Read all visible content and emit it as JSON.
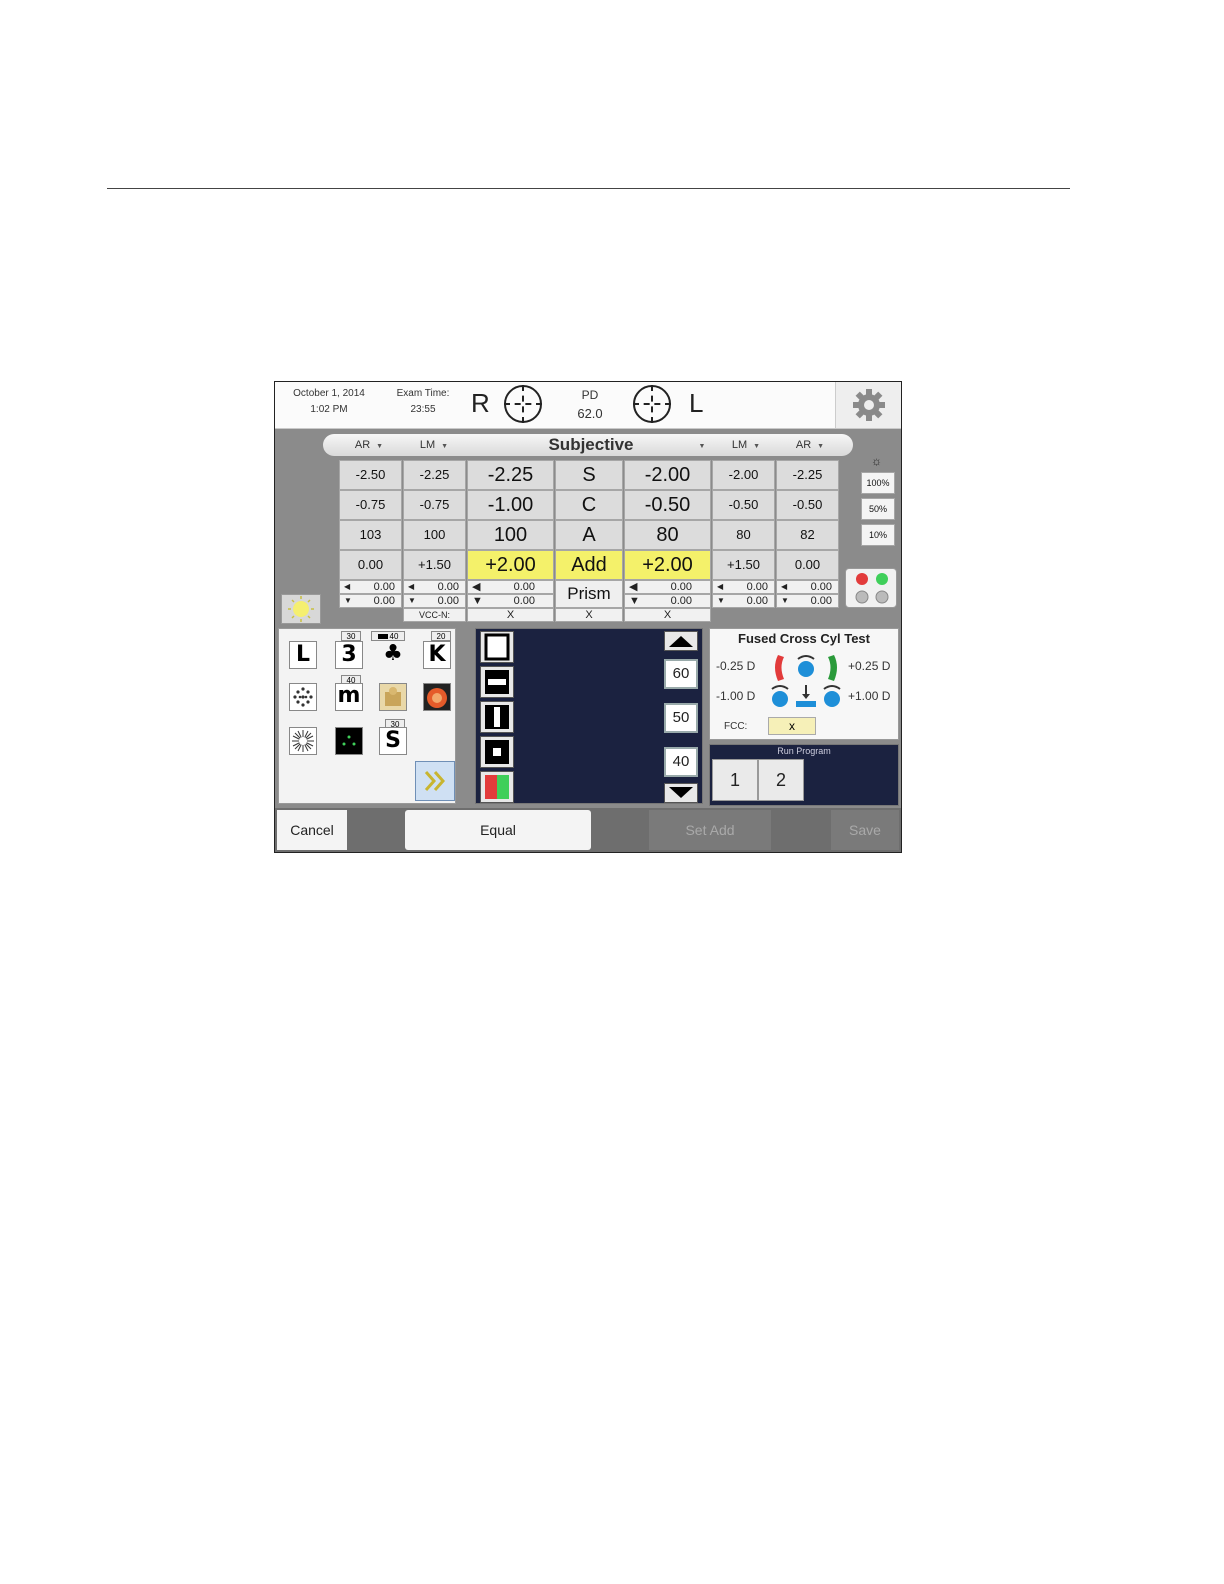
{
  "header": {
    "date": "October 1, 2014",
    "time": "1:02 PM",
    "exam_time_label": "Exam Time:",
    "exam_time": "23:55",
    "right_eye": "R",
    "left_eye": "L",
    "pd_label": "PD",
    "pd_value": "62.0"
  },
  "columns": {
    "ar_right": "AR",
    "lm_right": "LM",
    "subjective": "Subjective",
    "lm_left": "LM",
    "ar_left": "AR"
  },
  "rows": {
    "labels": [
      "S",
      "C",
      "A",
      "Add"
    ],
    "ar_right": [
      "-2.50",
      "-0.75",
      "103",
      "0.00"
    ],
    "lm_right": [
      "-2.25",
      "-0.75",
      "100",
      "+1.50"
    ],
    "subj_right": [
      "-2.25",
      "-1.00",
      "100",
      "+2.00"
    ],
    "subj_left": [
      "-2.00",
      "-0.50",
      "80",
      "+2.00"
    ],
    "lm_left": [
      "-2.00",
      "-0.50",
      "80",
      "+1.50"
    ],
    "ar_left": [
      "-2.25",
      "-0.50",
      "82",
      "0.00"
    ]
  },
  "prism": {
    "label": "Prism",
    "value": "0.00",
    "vcc_label": "VCC-N:",
    "x": "X"
  },
  "brightness": [
    "100%",
    "50%",
    "10%"
  ],
  "chart_icons": {
    "tag_30": "30",
    "tag_40": "40",
    "tag_20": "20",
    "letter_L": "L",
    "letter_3": "3",
    "letter_K": "K",
    "letter_m": "m",
    "letter_S": "S"
  },
  "distance_buttons": [
    "60",
    "50",
    "40"
  ],
  "fcc": {
    "title": "Fused Cross Cyl Test",
    "minus_025": "-0.25 D",
    "plus_025": "+0.25 D",
    "minus_100": "-1.00 D",
    "plus_100": "+1.00 D",
    "fcc_label": "FCC:",
    "fcc_value": "x"
  },
  "run_program": {
    "title": "Run Program",
    "programs": [
      "1",
      "2"
    ]
  },
  "bottom": {
    "cancel": "Cancel",
    "equal": "Equal",
    "set_add": "Set Add",
    "save": "Save"
  },
  "colors": {
    "highlight": "#f4f16a",
    "panel_dark": "#1b2240",
    "red": "#e23b3b",
    "green": "#3fcf5a",
    "blue": "#1e8fd8"
  }
}
